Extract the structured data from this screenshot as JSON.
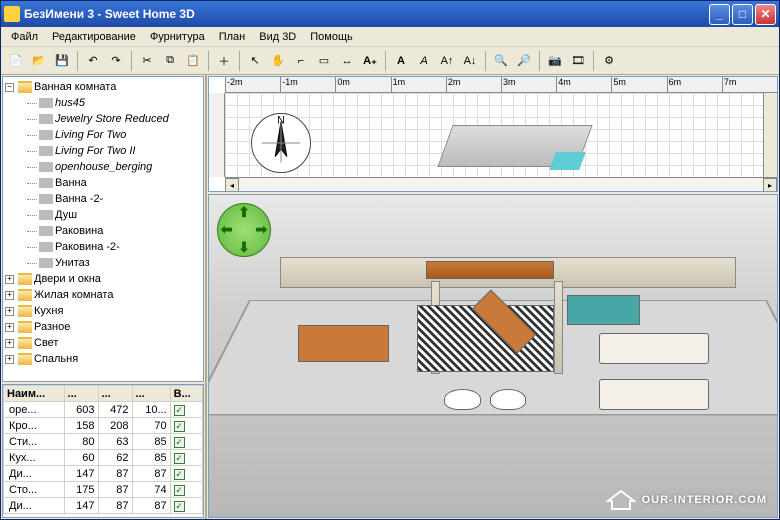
{
  "title": "БезИмени 3 - Sweet Home 3D",
  "menus": [
    "Файл",
    "Редактирование",
    "Фурнитура",
    "План",
    "Вид 3D",
    "Помощь"
  ],
  "toolbar_icons": [
    "new-icon",
    "open-icon",
    "save-icon",
    "undo-icon",
    "redo-icon",
    "cut-icon",
    "copy-icon",
    "paste-icon",
    "add-furniture-icon",
    "select-icon",
    "pan-icon",
    "wall-icon",
    "room-icon",
    "dimension-icon",
    "text-icon",
    "style-bold-icon",
    "style-italic-icon",
    "increase-icon",
    "decrease-icon",
    "zoom-in-icon",
    "zoom-out-icon",
    "create-photo-icon",
    "create-video-icon",
    "preferences-icon"
  ],
  "tree": {
    "root": "Ванная комната",
    "children": [
      {
        "label": "hus45",
        "italic": true
      },
      {
        "label": "Jewelry Store Reduced",
        "italic": true
      },
      {
        "label": "Living For Two",
        "italic": true
      },
      {
        "label": "Living For Two II",
        "italic": true
      },
      {
        "label": "openhouse_berging",
        "italic": true
      },
      {
        "label": "Ванна",
        "italic": false
      },
      {
        "label": "Ванна -2-",
        "italic": false
      },
      {
        "label": "Душ",
        "italic": false
      },
      {
        "label": "Раковина",
        "italic": false
      },
      {
        "label": "Раковина -2-",
        "italic": false
      },
      {
        "label": "Унитаз",
        "italic": false
      }
    ],
    "siblings": [
      "Двери и окна",
      "Жилая комната",
      "Кухня",
      "Разное",
      "Свет",
      "Спальня"
    ]
  },
  "furniture_table": {
    "headers": [
      "Наим...",
      "...",
      "...",
      "...",
      "В..."
    ],
    "rows": [
      {
        "name": "ope...",
        "w": "603",
        "d": "472",
        "h": "10...",
        "vis": true
      },
      {
        "name": "Кро...",
        "w": "158",
        "d": "208",
        "h": "70",
        "vis": true
      },
      {
        "name": "Сти...",
        "w": "80",
        "d": "63",
        "h": "85",
        "vis": true
      },
      {
        "name": "Кух...",
        "w": "60",
        "d": "62",
        "h": "85",
        "vis": true
      },
      {
        "name": "Ди...",
        "w": "147",
        "d": "87",
        "h": "87",
        "vis": true
      },
      {
        "name": "Сто...",
        "w": "175",
        "d": "87",
        "h": "74",
        "vis": true
      },
      {
        "name": "Ди...",
        "w": "147",
        "d": "87",
        "h": "87",
        "vis": true
      }
    ]
  },
  "ruler_ticks": [
    "-2m",
    "-1m",
    "0m",
    "1m",
    "2m",
    "3m",
    "4m",
    "5m",
    "6m",
    "7m"
  ],
  "compass_label": "N",
  "watermark": "OUR-INTERIOR.COM"
}
